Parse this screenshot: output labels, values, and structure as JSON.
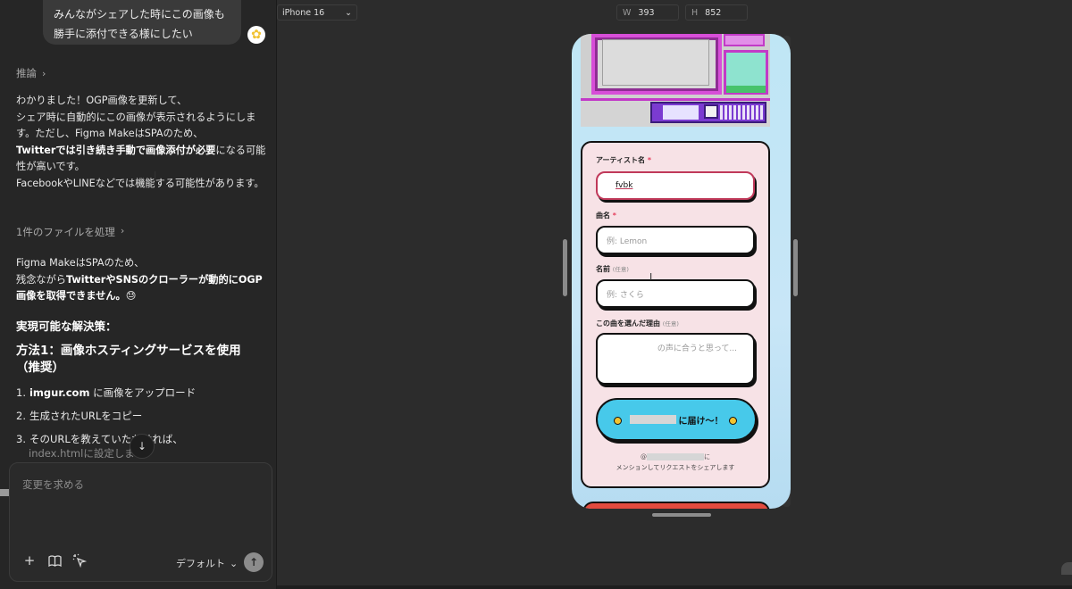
{
  "chat": {
    "user_message": "みんながシェアした時にこの画像も勝手に添付できる様にしたい",
    "reasoning_label": "推論",
    "response": {
      "p1_line1": "わかりました！OGP画像を更新して、",
      "p1_line2": "シェア時に自動的にこの画像が表示されるようにします。ただし、Figma MakeはSPAのため、",
      "p1_bold": "Twitterでは引き続き手動で画像添付が必要",
      "p1_line3": "になる可能性が高いです。",
      "p1_line4": "FacebookやLINEなどでは機能する可能性があります。"
    },
    "files_processed": "1件のファイルを処理",
    "p2_line1": "Figma MakeはSPAのため、",
    "p2_pre": "残念ながら",
    "p2_bold": "TwitterやSNSのクローラーが動的にOGP画像を取得できません。",
    "p2_emoji": "😓",
    "solutions_heading": "実現可能な解決策：",
    "method1_heading": "方法1：画像ホスティングサービスを使用（推奨）",
    "steps": [
      {
        "num": "1.",
        "bold": "imgur.com",
        "text": " に画像をアップロード"
      },
      {
        "num": "2.",
        "bold": "",
        "text": "生成されたURLをコピー"
      },
      {
        "num": "3.",
        "bold": "",
        "text": "そのURLを教えていただければ、"
      }
    ],
    "step3_cont": "index.htmlに設定しま",
    "composer_placeholder": "変更を求める",
    "model_label": "デフォルト"
  },
  "canvas": {
    "device": "iPhone 16",
    "width_label": "W",
    "width_value": "393",
    "height_label": "H",
    "height_value": "852"
  },
  "form": {
    "artist_label": "アーティスト名",
    "artist_value": "fvbk",
    "song_label": "曲名",
    "song_placeholder": "例: Lemon",
    "name_label": "名前",
    "optional": "(任意)",
    "name_placeholder": "例: さくら",
    "reason_label": "この曲を選んだ理由",
    "reason_placeholder": "の声に合うと思って...",
    "submit_label": "に届け〜！",
    "footer_suffix": "に",
    "footer_line2": "メンションしてリクエストをシェアします",
    "required_mark": "*",
    "at_mark": "@"
  },
  "colors": {
    "phone_bg": "#bfe6f5",
    "form_bg": "#f7e2e6",
    "submit_bg": "#47c9ea",
    "required": "#e53c5a"
  }
}
